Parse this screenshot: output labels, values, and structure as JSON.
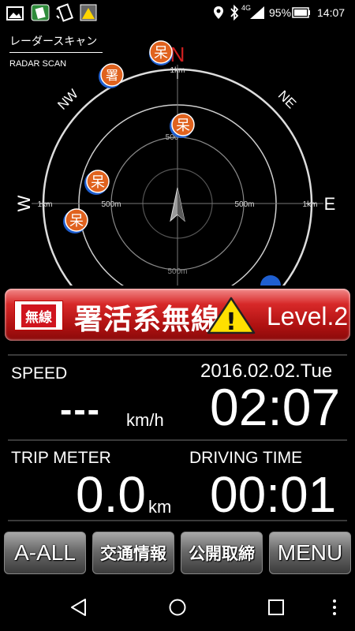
{
  "status_bar": {
    "network": "4G",
    "battery": "95%",
    "time": "14:07"
  },
  "radar": {
    "title_jp": "レーダースキャン",
    "title_en": "RADAR SCAN",
    "compass": {
      "n": "N",
      "ne": "NE",
      "nw": "NW",
      "e": "E",
      "w": "W"
    },
    "range_labels": {
      "top_1km": "1km",
      "left_1km": "1km",
      "right_1km": "1km",
      "left_500m": "500m",
      "right_500m": "500m",
      "top_500m": "500",
      "bottom_500m": "500m"
    },
    "marker_glyph": "呆",
    "marker_glyph_alt": "署"
  },
  "alert": {
    "badge": "無線",
    "title": "署活系無線",
    "warning_glyph": "!",
    "level": "Level.2"
  },
  "info": {
    "speed_label": "SPEED",
    "speed_value": "---",
    "speed_unit": "km/h",
    "date": "2016.02.02.Tue",
    "clock": "02:07",
    "trip_label": "TRIP METER",
    "trip_value": "0.0",
    "trip_unit": "km",
    "driving_label": "DRIVING TIME",
    "driving_value": "00:01"
  },
  "buttons": {
    "a_all": "A-ALL",
    "traffic": "交通情報",
    "public_enforcement": "公開取締",
    "menu": "MENU"
  },
  "colors": {
    "alert_red": "#c41a1a",
    "marker_orange": "#e0621e",
    "marker_blue": "#1f5fd0"
  }
}
